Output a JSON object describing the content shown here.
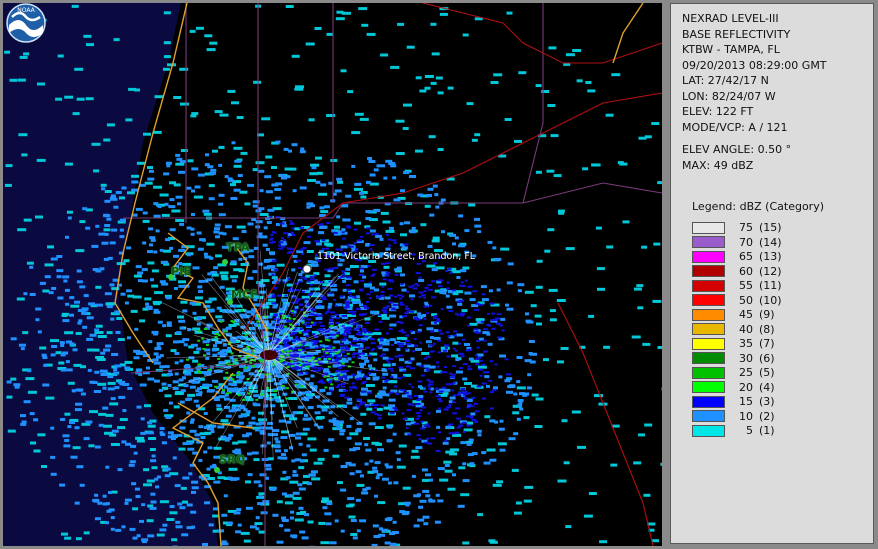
{
  "map": {
    "cities": [
      {
        "code": "TPA"
      },
      {
        "code": "PIE"
      },
      {
        "code": "MCF"
      },
      {
        "code": "SRQ"
      }
    ],
    "address_marker": {
      "label": "1101 Victoria Street, Brandon, FL"
    },
    "logo": {
      "text": "NOAA",
      "icon": "noaa-logo-icon"
    }
  },
  "info": {
    "product": "NEXRAD LEVEL-III",
    "type": "BASE REFLECTIVITY",
    "station": "KTBW - TAMPA, FL",
    "datetime": "09/20/2013 08:29:00 GMT",
    "lat": "LAT: 27/42/17 N",
    "lon": "LON: 82/24/07 W",
    "elev": "ELEV: 122 FT",
    "mode": "MODE/VCP: A / 121",
    "elev_angle": "ELEV ANGLE: 0.50 °",
    "max": "MAX: 49 dBZ"
  },
  "legend": {
    "title": "Legend: dBZ (Category)",
    "items": [
      {
        "value": "75",
        "category": "(15)",
        "color": "#e8e8e8"
      },
      {
        "value": "70",
        "category": "(14)",
        "color": "#9a5ccc"
      },
      {
        "value": "65",
        "category": "(13)",
        "color": "#ff00ff"
      },
      {
        "value": "60",
        "category": "(12)",
        "color": "#b00000"
      },
      {
        "value": "55",
        "category": "(11)",
        "color": "#d40000"
      },
      {
        "value": "50",
        "category": "(10)",
        "color": "#ff0000"
      },
      {
        "value": "45",
        "category": "(9)",
        "color": "#ff8c00"
      },
      {
        "value": "40",
        "category": "(8)",
        "color": "#e8b800"
      },
      {
        "value": "35",
        "category": "(7)",
        "color": "#ffff00"
      },
      {
        "value": "30",
        "category": "(6)",
        "color": "#008c00"
      },
      {
        "value": "25",
        "category": "(5)",
        "color": "#00c000"
      },
      {
        "value": "20",
        "category": "(4)",
        "color": "#00ff00"
      },
      {
        "value": "15",
        "category": "(3)",
        "color": "#0000ff"
      },
      {
        "value": "10",
        "category": "(2)",
        "color": "#1e90ff"
      },
      {
        "value": "5",
        "category": "(1)",
        "color": "#00e5e5"
      }
    ]
  },
  "colors": {
    "water": "#0a0a40",
    "land": "#000000",
    "coastline": "#e0a030",
    "county_lines": "#7a3a7a",
    "roads": "#b01010",
    "cyan_echo": "#00c8d8",
    "light_blue_echo": "#1e90ff",
    "blue_echo": "#1010e0",
    "green_echo": "#10d010"
  }
}
